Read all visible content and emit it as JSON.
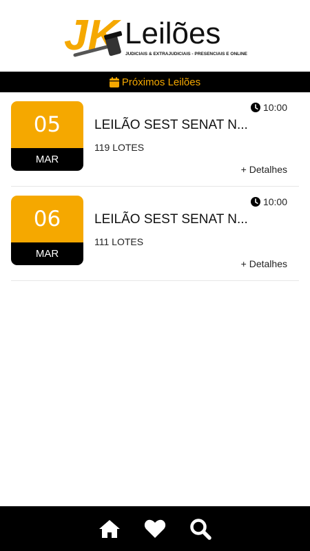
{
  "header": {
    "logo_mark": "JK",
    "logo_text": "Leilões",
    "logo_tagline": "JUDICIAIS & EXTRAJUDICIAIS - PRESENCIAIS E ONLINE"
  },
  "section": {
    "title": "Próximos Leilões",
    "icon": "calendar-icon"
  },
  "auctions": [
    {
      "day": "05",
      "month": "MAR",
      "time": "10:00",
      "title": "LEILÃO SEST SENAT N...",
      "lots": "119 LOTES",
      "details_label": "+ Detalhes"
    },
    {
      "day": "06",
      "month": "MAR",
      "time": "10:00",
      "title": "LEILÃO SEST SENAT N...",
      "lots": "111 LOTES",
      "details_label": "+ Detalhes"
    }
  ],
  "nav": {
    "items": [
      "home-icon",
      "heart-icon",
      "search-icon"
    ]
  },
  "colors": {
    "accent": "#f5a800",
    "dark": "#000000"
  }
}
